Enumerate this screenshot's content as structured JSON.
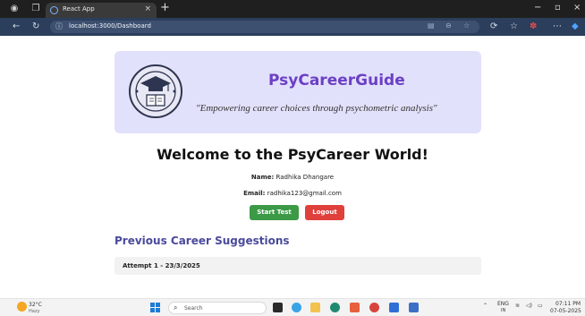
{
  "browser": {
    "tab_title": "React App",
    "url": "localhost:3000/Dashboard",
    "tab_close_glyph": "×",
    "new_tab_glyph": "+",
    "window_controls": {
      "minimize": "−",
      "maximize": "▫",
      "close": "×"
    }
  },
  "header": {
    "brand": "PsyCareerGuide",
    "tagline": "\"Empowering career choices through psychometric analysis\"",
    "logo_icon": "graduation-cap-book-logo"
  },
  "welcome": {
    "title": "Welcome to the PsyCareer World!",
    "name_label": "Name:",
    "name_value": "Radhika Dhangare",
    "email_label": "Email:",
    "email_value": "radhika123@gmail.com"
  },
  "actions": {
    "start_test": "Start Test",
    "logout": "Logout"
  },
  "suggestions": {
    "title": "Previous Career Suggestions",
    "attempts": [
      {
        "label": "Attempt 1 - 23/3/2025"
      }
    ]
  },
  "taskbar": {
    "weather_temp": "32°C",
    "weather_cond": "Hazy",
    "search_placeholder": "Search",
    "language_top": "ENG",
    "language_bottom": "IN",
    "time": "07:11 PM",
    "date": "07-05-2025"
  },
  "colors": {
    "hero_bg": "#e1e1fb",
    "brand": "#6c3fc4",
    "start_button": "#3c9a46",
    "logout_button": "#e0403b",
    "section_title": "#4a4a9c"
  }
}
